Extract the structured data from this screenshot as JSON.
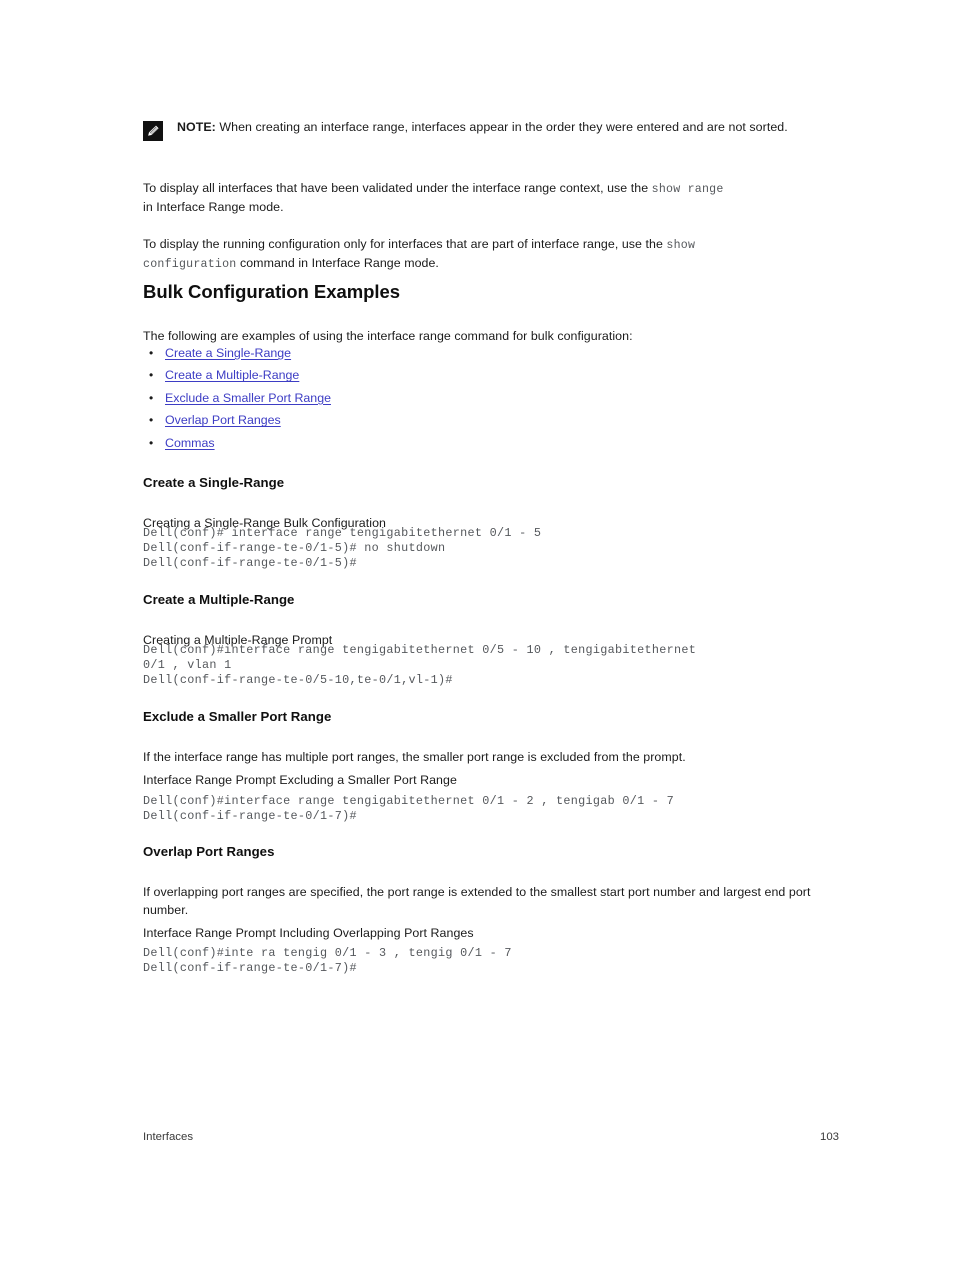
{
  "note": {
    "icon": "note-pencil-icon",
    "label": "NOTE:",
    "text": " When creating an interface range, interfaces appear in the order they were entered and are not sorted."
  },
  "paragraphs": {
    "p1_before": "To display all interfaces that have been validated under the interface range context, use the ",
    "p1_code": "show range",
    "p1_after": "in Interface Range mode.",
    "p2_before": "To display the running configuration only for interfaces that are part of interface range, use the ",
    "p2_code1": "show",
    "p2_code2": "configuration",
    "p2_after": " command in Interface Range mode."
  },
  "section": {
    "title": "Bulk Configuration Examples",
    "intro": "The following are examples of using the interface range command for bulk configuration:"
  },
  "links": [
    {
      "label": "Create a Single-Range"
    },
    {
      "label": "Create a Multiple-Range"
    },
    {
      "label": "Exclude a Smaller Port Range"
    },
    {
      "label": "Overlap Port Ranges"
    },
    {
      "label": "Commas"
    }
  ],
  "subsections": {
    "single_range": {
      "heading": "Create a Single-Range",
      "caption": "Creating a Single-Range Bulk Configuration",
      "code": "Dell(conf)# interface range tengigabitethernet 0/1 - 5\nDell(conf-if-range-te-0/1-5)# no shutdown\nDell(conf-if-range-te-0/1-5)#"
    },
    "multiple_range": {
      "heading": "Create a Multiple-Range",
      "caption": "Creating a Multiple-Range Prompt",
      "code": "Dell(conf)#interface range tengigabitethernet 0/5 - 10 , tengigabitethernet\n0/1 , vlan 1\nDell(conf-if-range-te-0/5-10,te-0/1,vl-1)#"
    },
    "exclude_smaller": {
      "heading": "Exclude a Smaller Port Range",
      "body": "If the interface range has multiple port ranges, the smaller port range is excluded from the prompt.",
      "caption": "Interface Range Prompt Excluding a Smaller Port Range",
      "code": "Dell(conf)#interface range tengigabitethernet 0/1 - 2 , tengigab 0/1 - 7\nDell(conf-if-range-te-0/1-7)#"
    },
    "overlap_ranges": {
      "heading": "Overlap Port Ranges",
      "body": "If overlapping port ranges are specified, the port range is extended to the smallest start port number and largest end port number.",
      "caption": "Interface Range Prompt Including Overlapping Port Ranges",
      "code": "Dell(conf)#inte ra tengig 0/1 - 3 , tengig 0/1 - 7\nDell(conf-if-range-te-0/1-7)#"
    }
  },
  "footer": {
    "chapter": "Interfaces",
    "page_number": "103"
  },
  "colors": {
    "link": "#3d3dc4",
    "text": "#1b1b1b",
    "code": "#55585c"
  }
}
